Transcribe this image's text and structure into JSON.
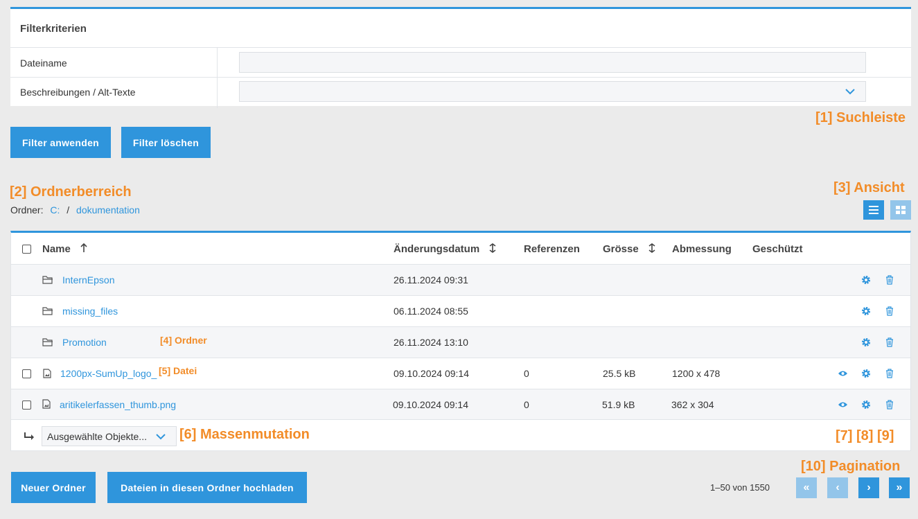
{
  "filter": {
    "title": "Filterkriterien",
    "fields": [
      {
        "label": "Dateiname",
        "value": "",
        "placeholder": ""
      },
      {
        "label": "Beschreibungen / Alt-Texte",
        "value": ""
      }
    ],
    "apply_label": "Filter anwenden",
    "clear_label": "Filter löschen"
  },
  "annotations": {
    "a1": "[1] Suchleiste",
    "a2": "[2] Ordnerberreich",
    "a3": "[3] Ansicht",
    "a4": "[4] Ordner",
    "a5": "[5] Datei",
    "a6": "[6] Massenmutation",
    "a7": "[7] [8] [9]",
    "a10": "[10] Pagination"
  },
  "breadcrumb": {
    "label": "Ordner:",
    "parts": [
      "C:",
      "/",
      "dokumentation"
    ]
  },
  "table": {
    "headers": {
      "name": "Name",
      "date": "Änderungsdatum",
      "refs": "Referenzen",
      "size": "Grösse",
      "dim": "Abmessung",
      "prot": "Geschützt"
    },
    "rows": [
      {
        "type": "folder",
        "name": "InternEpson",
        "date": "26.11.2024 09:31",
        "refs": "",
        "size": "",
        "dim": ""
      },
      {
        "type": "folder",
        "name": "missing_files",
        "date": "06.11.2024 08:55",
        "refs": "",
        "size": "",
        "dim": ""
      },
      {
        "type": "folder",
        "name": "Promotion",
        "date": "26.11.2024 13:10",
        "refs": "",
        "size": "",
        "dim": ""
      },
      {
        "type": "file",
        "name": "1200px-SumUp_logo_",
        "date": "09.10.2024 09:14",
        "refs": "0",
        "size": "25.5 kB",
        "dim": "1200 x 478"
      },
      {
        "type": "file",
        "name": "aritikelerfassen_thumb.png",
        "date": "09.10.2024 09:14",
        "refs": "0",
        "size": "51.9 kB",
        "dim": "362 x 304"
      }
    ],
    "bulk_select": "Ausgewählte Objekte..."
  },
  "actions": {
    "new_folder": "Neuer Ordner",
    "upload": "Dateien in diesen Ordner hochladen"
  },
  "pagination": {
    "range": "1–50 von 1550",
    "first": "«",
    "prev": "‹",
    "next": "›",
    "last": "»"
  },
  "colors": {
    "accent": "#2f95dc",
    "annotation": "#f28c28"
  }
}
